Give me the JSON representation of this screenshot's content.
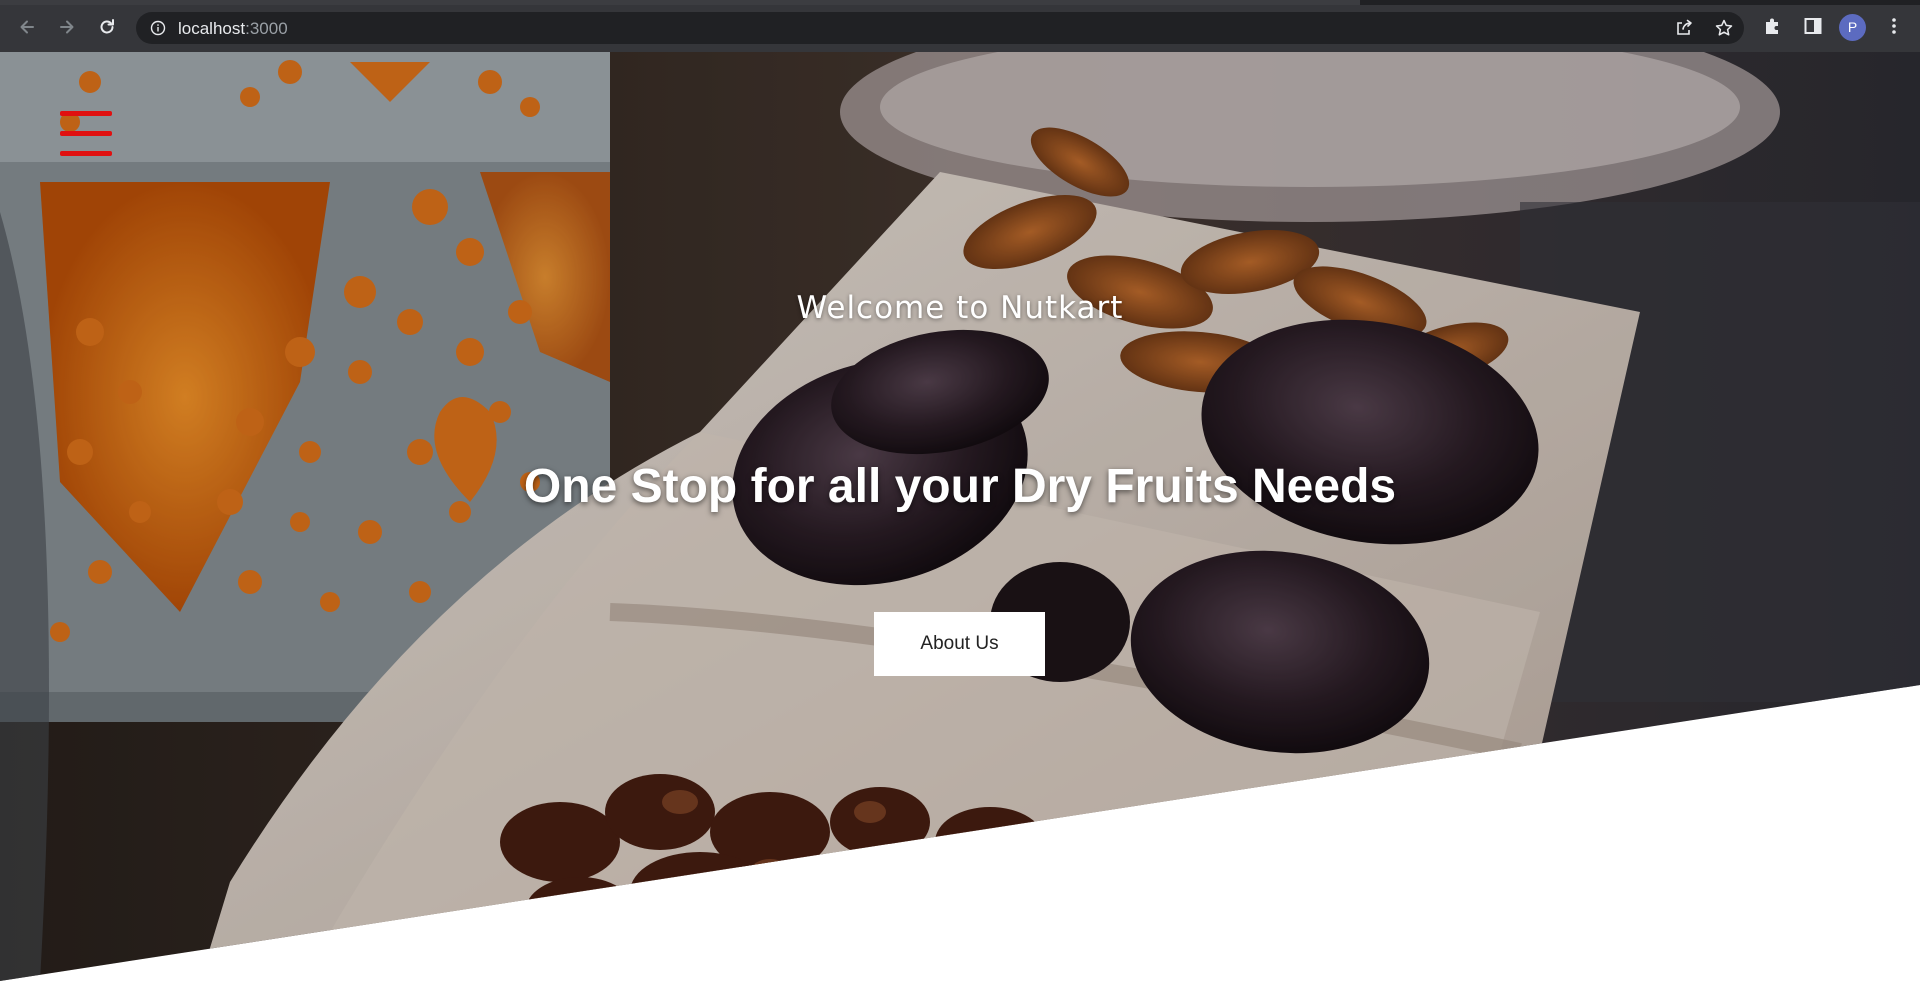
{
  "browser": {
    "url_host": "localhost",
    "url_port": ":3000",
    "profile_initial": "P",
    "icons": {
      "back": "arrow-left-icon",
      "forward": "arrow-right-icon",
      "reload": "reload-icon",
      "site_info": "info-icon",
      "share": "share-icon",
      "bookmark": "star-icon",
      "extensions": "puzzle-icon",
      "side_panel": "side-panel-icon",
      "menu": "more-vertical-icon"
    }
  },
  "hero": {
    "welcome_text": "Welcome to Nutkart",
    "headline": "One Stop for all your Dry Fruits Needs",
    "cta_label": "About Us",
    "menu_icon": "hamburger-menu-icon",
    "colors": {
      "menu_icon": "#e01010",
      "cta_background": "#ffffff",
      "text": "#ffffff"
    }
  }
}
